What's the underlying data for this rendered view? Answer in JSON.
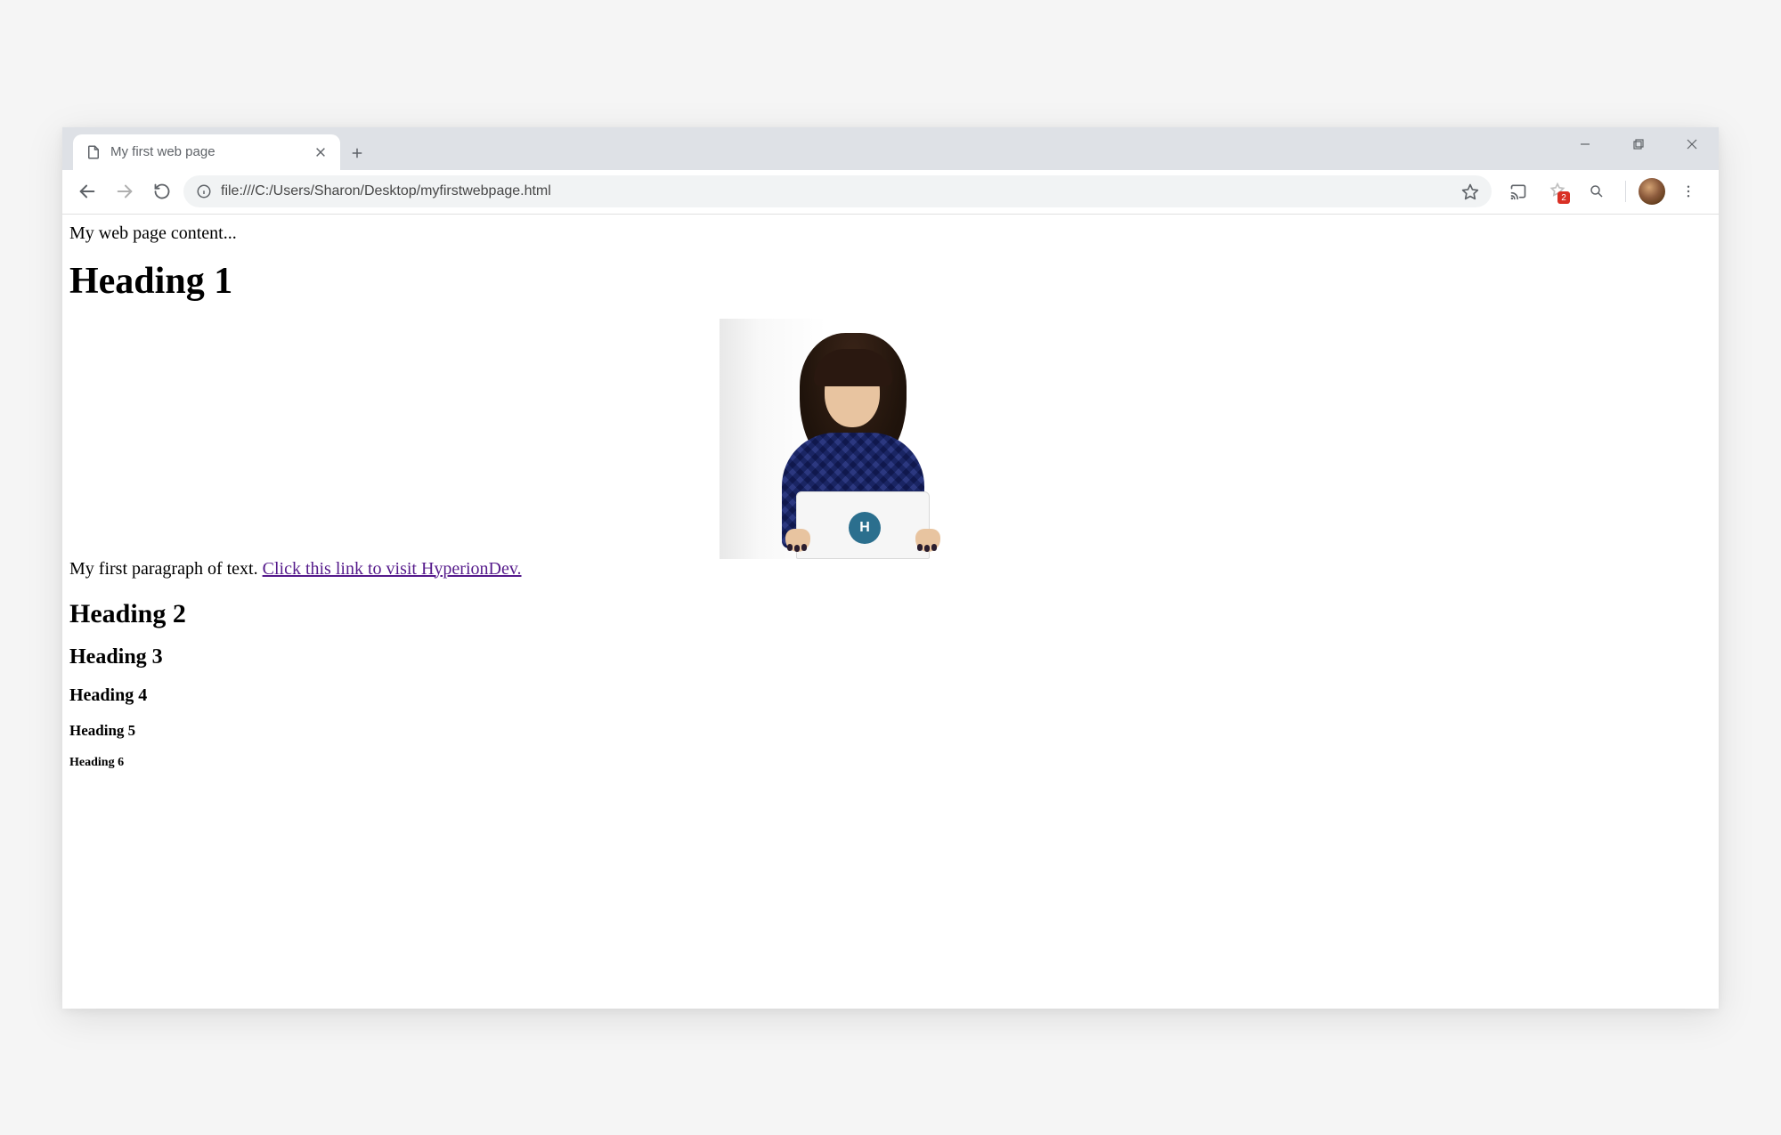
{
  "tab": {
    "title": "My first web page"
  },
  "addressBar": {
    "url": "file:///C:/Users/Sharon/Desktop/myfirstwebpage.html"
  },
  "extensions": {
    "badgeCount": "2"
  },
  "page": {
    "intro": "My web page content...",
    "h1": "Heading 1",
    "paragraphPrefix": "My first paragraph of text. ",
    "linkText": "Click this link to visit HyperionDev.",
    "h2": "Heading 2",
    "h3": "Heading 3",
    "h4": "Heading 4",
    "h5": "Heading 5",
    "h6": "Heading 6"
  }
}
